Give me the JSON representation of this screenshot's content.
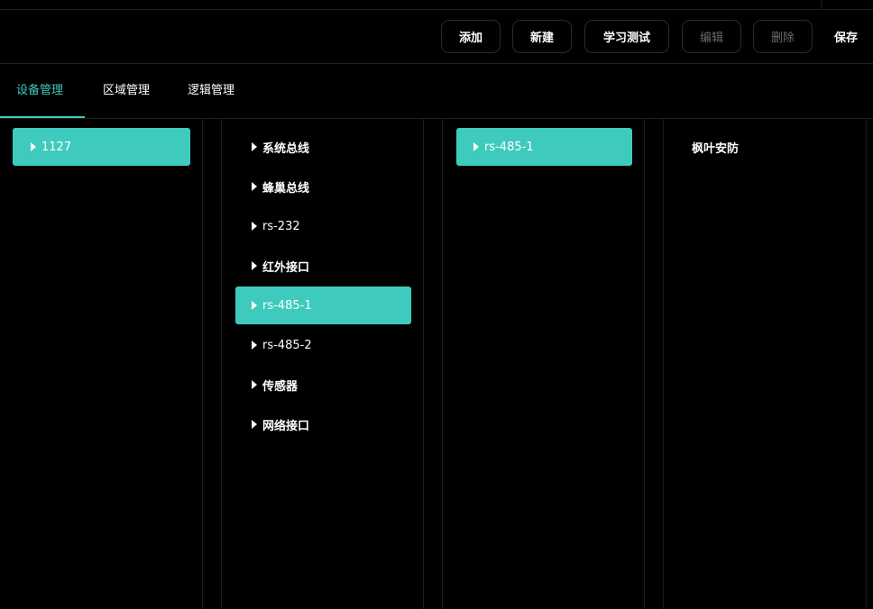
{
  "toolbar": {
    "add": "添加",
    "new": "新建",
    "learn_test": "学习测试",
    "edit": "编辑",
    "delete": "删除",
    "save": "保存"
  },
  "tabs": [
    {
      "label": "设备管理",
      "active": true
    },
    {
      "label": "区域管理",
      "active": false
    },
    {
      "label": "逻辑管理",
      "active": false
    }
  ],
  "columns": {
    "devices": [
      {
        "label": "1127",
        "selected": true
      }
    ],
    "interfaces": [
      {
        "label": "系统总线",
        "selected": false
      },
      {
        "label": "蜂巢总线",
        "selected": false
      },
      {
        "label": "rs-232",
        "selected": false
      },
      {
        "label": "红外接口",
        "selected": false
      },
      {
        "label": "rs-485-1",
        "selected": true
      },
      {
        "label": "rs-485-2",
        "selected": false
      },
      {
        "label": "传感器",
        "selected": false
      },
      {
        "label": "网络接口",
        "selected": false
      }
    ],
    "ports": [
      {
        "label": "rs-485-1",
        "selected": true
      }
    ],
    "endpoints": [
      {
        "label": "枫叶安防",
        "selected": false
      }
    ]
  },
  "colors": {
    "accent": "#3ecbbd",
    "background": "#000000",
    "disabled_text": "#6b6b6b"
  }
}
